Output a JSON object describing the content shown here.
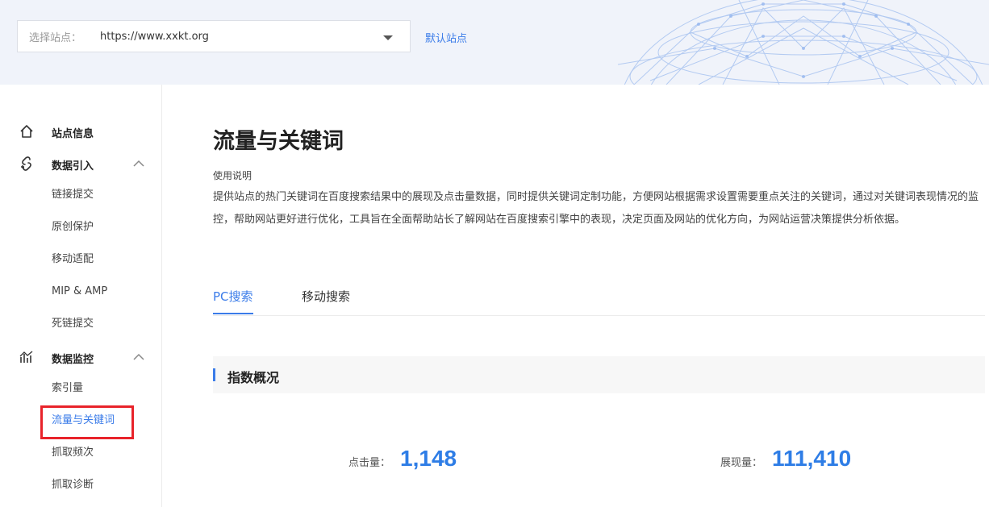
{
  "header": {
    "site_select_label": "选择站点：",
    "site_select_value": "https://www.xxkt.org",
    "default_site_link": "默认站点"
  },
  "sidebar": {
    "groups": [
      {
        "label": "站点信息",
        "icon": "home-icon",
        "expanded": false,
        "items": []
      },
      {
        "label": "数据引入",
        "icon": "data-import-icon",
        "expanded": true,
        "items": [
          "链接提交",
          "原创保护",
          "移动适配",
          "MIP & AMP",
          "死链提交"
        ]
      },
      {
        "label": "数据监控",
        "icon": "chart-monitor-icon",
        "expanded": true,
        "items": [
          "索引量",
          "流量与关键词",
          "抓取频次",
          "抓取诊断"
        ]
      }
    ],
    "active_item": "流量与关键词"
  },
  "main": {
    "title": "流量与关键词",
    "usage_title": "使用说明",
    "usage_desc": "提供站点的热门关键词在百度搜索结果中的展现及点击量数据，同时提供关键词定制功能，方便网站根据需求设置需要重点关注的关键词，通过对关键词表现情况的监控，帮助网站更好进行优化，工具旨在全面帮助站长了解网站在百度搜索引擎中的表现，决定页面及网站的优化方向，为网站运营决策提供分析依据。",
    "tabs": [
      {
        "label": "PC搜索",
        "active": true
      },
      {
        "label": "移动搜索",
        "active": false
      }
    ],
    "section_title": "指数概况",
    "metrics": [
      {
        "label": "点击量：",
        "value": "1,148"
      },
      {
        "label": "展现量：",
        "value": "111,410"
      }
    ]
  },
  "colors": {
    "accent": "#3b7ce9",
    "metric_value": "#2e7de6",
    "highlight_box": "#e8232a",
    "header_bg": "#f0f3fa"
  }
}
